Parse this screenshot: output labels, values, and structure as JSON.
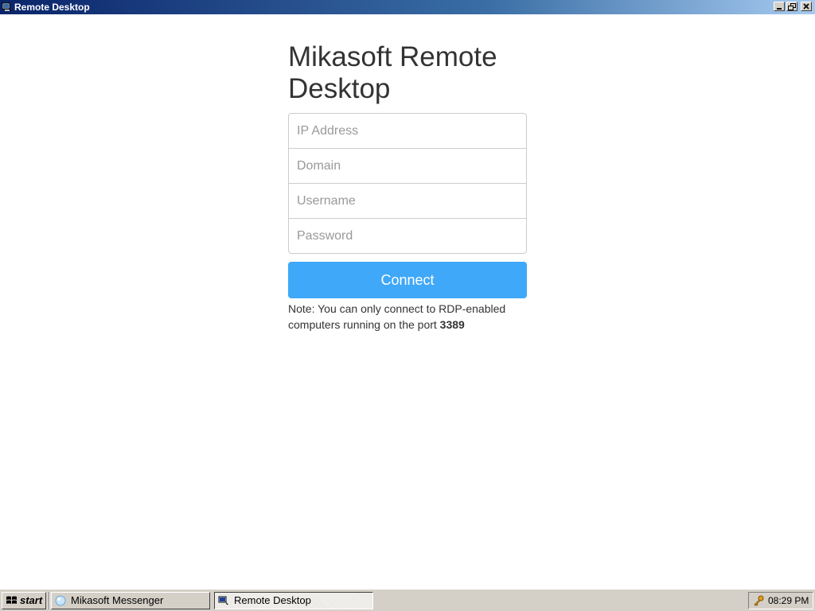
{
  "window": {
    "title": "Remote Desktop",
    "icon": "remote-desktop-icon",
    "controls": [
      "minimize-icon",
      "restore-icon",
      "close-icon"
    ]
  },
  "main": {
    "heading": "Mikasoft Remote Desktop",
    "fields": {
      "ip": {
        "placeholder": "IP Address",
        "value": ""
      },
      "domain": {
        "placeholder": "Domain",
        "value": ""
      },
      "username": {
        "placeholder": "Username",
        "value": ""
      },
      "password": {
        "placeholder": "Password",
        "value": ""
      }
    },
    "connect_label": "Connect",
    "note_text": "Note: You can only connect to RDP-enabled computers running on the port ",
    "note_port": "3389"
  },
  "taskbar": {
    "start_label": "start",
    "tasks": [
      {
        "label": "Mikasoft Messenger",
        "icon": "messenger-icon",
        "active": false
      },
      {
        "label": "Remote Desktop",
        "icon": "remote-desktop-icon",
        "active": true
      }
    ],
    "clock": "08:29 PM",
    "tray_icon": "key-icon"
  },
  "colors": {
    "accent": "#3fa8f8",
    "titlebar": "#0a246a",
    "taskbar": "#d4d0c8"
  }
}
